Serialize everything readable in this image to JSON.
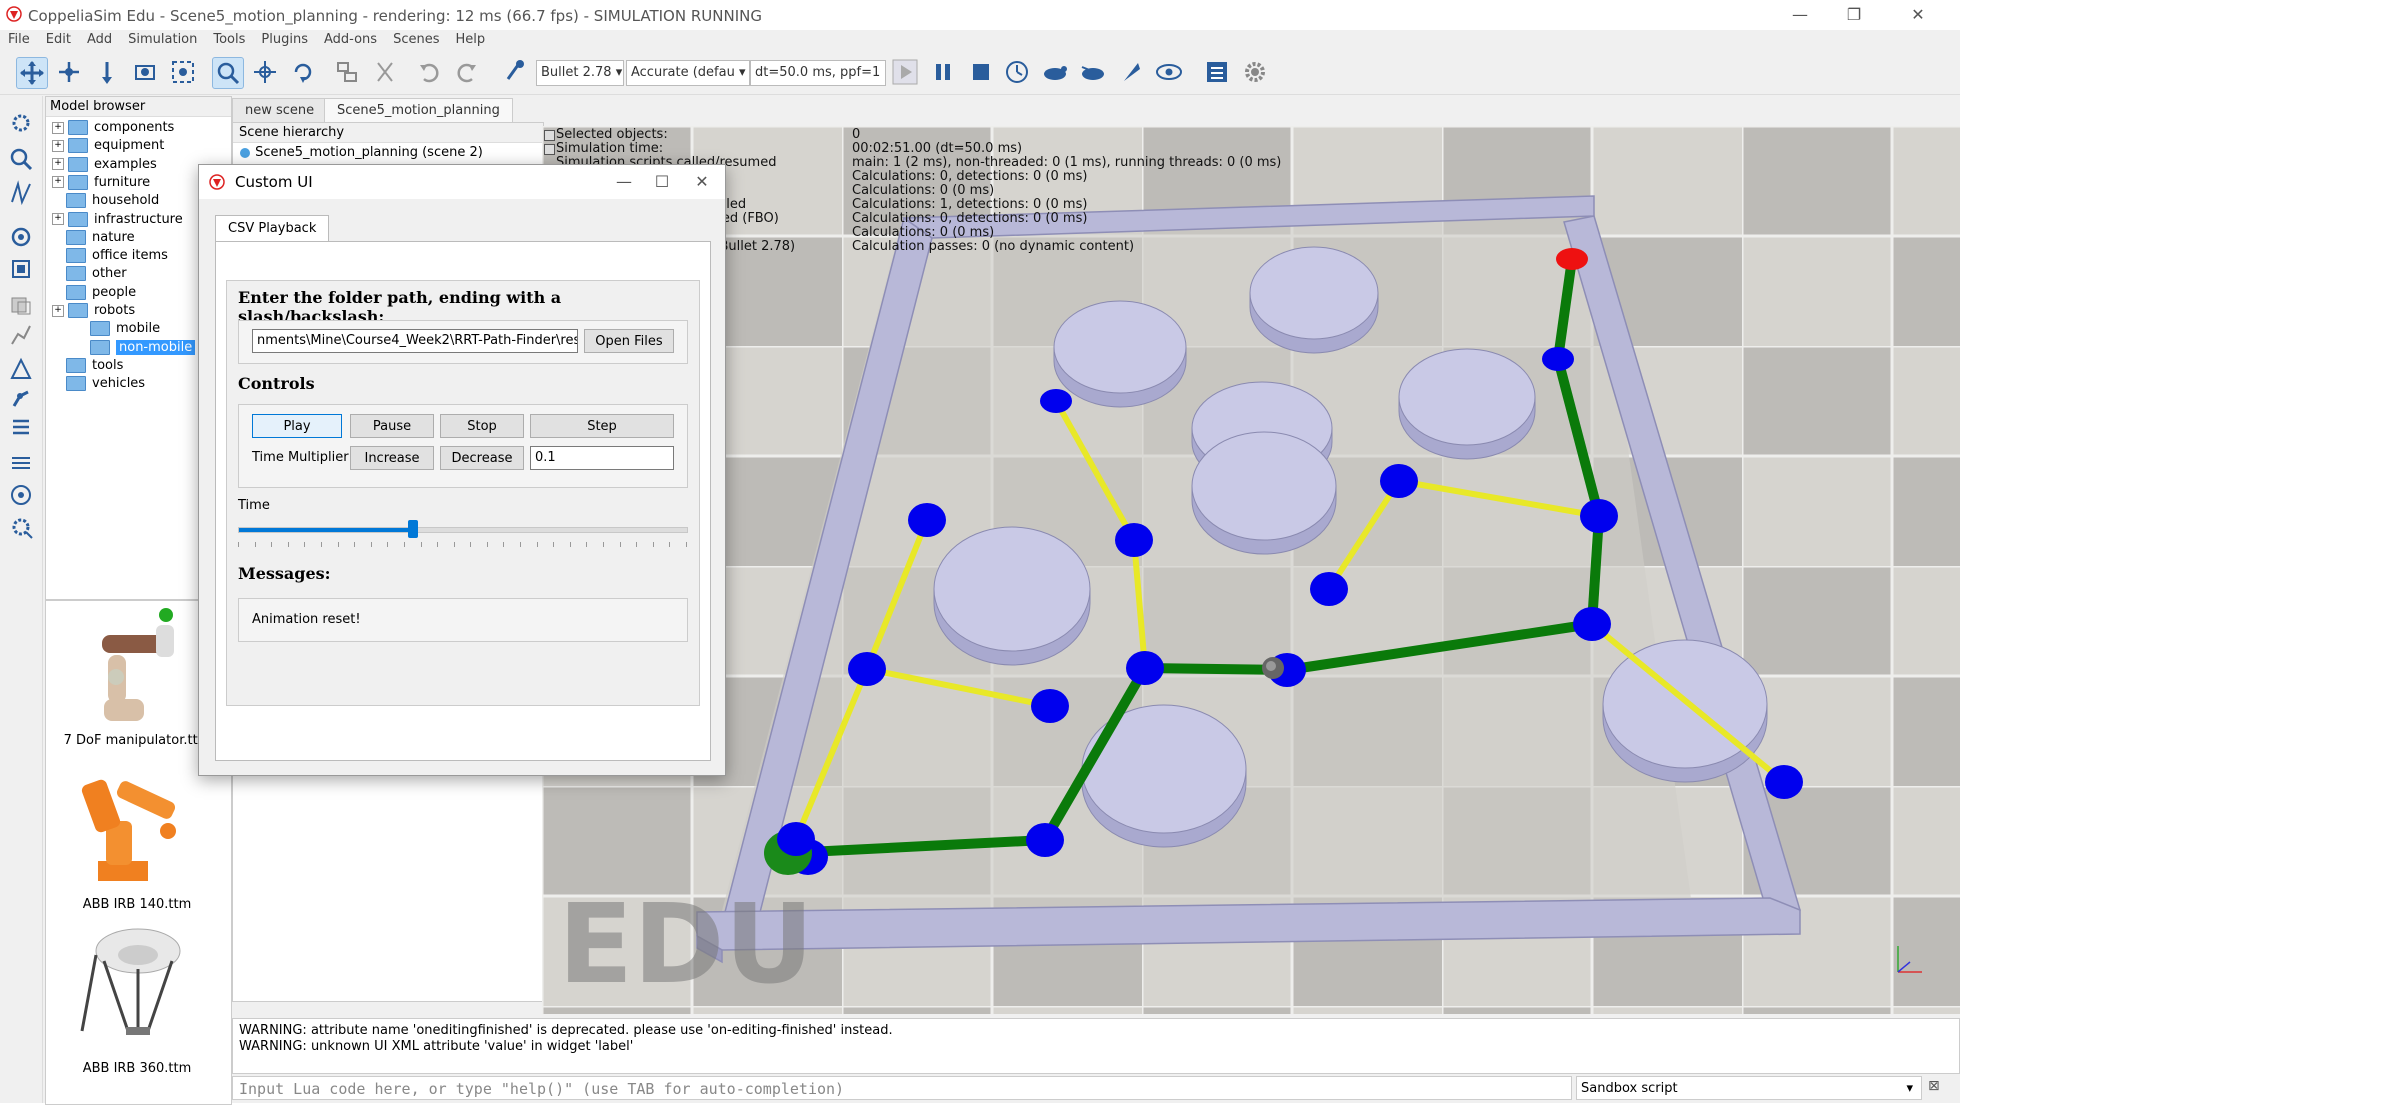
{
  "window": {
    "title": "CoppeliaSim Edu - Scene5_motion_planning - rendering: 12 ms (66.7 fps) - SIMULATION RUNNING",
    "minimize": "—",
    "maximize": "❐",
    "close": "✕"
  },
  "menu": [
    "File",
    "Edit",
    "Add",
    "Simulation",
    "Tools",
    "Plugins",
    "Add-ons",
    "Scenes",
    "Help"
  ],
  "toolbar": {
    "engine": "Bullet 2.78",
    "accuracy": "Accurate (defau",
    "timestep": "dt=50.0 ms, ppf=1"
  },
  "model_browser": {
    "title": "Model browser",
    "items": [
      {
        "label": "components",
        "expandable": true,
        "indent": 0
      },
      {
        "label": "equipment",
        "expandable": true,
        "indent": 0
      },
      {
        "label": "examples",
        "expandable": true,
        "indent": 0
      },
      {
        "label": "furniture",
        "expandable": true,
        "indent": 0
      },
      {
        "label": "household",
        "expandable": false,
        "indent": 0
      },
      {
        "label": "infrastructure",
        "expandable": true,
        "indent": 0
      },
      {
        "label": "nature",
        "expandable": false,
        "indent": 0
      },
      {
        "label": "office items",
        "expandable": false,
        "indent": 0
      },
      {
        "label": "other",
        "expandable": false,
        "indent": 0
      },
      {
        "label": "people",
        "expandable": false,
        "indent": 0
      },
      {
        "label": "robots",
        "expandable": true,
        "indent": 0
      },
      {
        "label": "mobile",
        "expandable": false,
        "indent": 1
      },
      {
        "label": "non-mobile",
        "expandable": false,
        "indent": 1,
        "selected": true
      },
      {
        "label": "tools",
        "expandable": false,
        "indent": 0
      },
      {
        "label": "vehicles",
        "expandable": false,
        "indent": 0
      }
    ],
    "thumbnails": [
      "7 DoF manipulator.ttm",
      "ABB IRB 140.ttm",
      "ABB IRB 360.ttm"
    ]
  },
  "scene_tabs": [
    "new scene",
    "Scene5_motion_planning"
  ],
  "hierarchy": {
    "title": "Scene hierarchy",
    "root": "Scene5_motion_planning (scene 2)"
  },
  "info_overlay": {
    "labels": [
      "Selected objects:",
      "Simulation time:",
      "Simulation scripts called/resumed",
      "abled",
      "bled (FBO)",
      "d (Bullet 2.78)"
    ],
    "values": [
      "0",
      "00:02:51.00 (dt=50.0 ms)",
      "main: 1 (2 ms), non-threaded: 0 (1 ms), running threads: 0 (0 ms)",
      "Calculations: 0, detections: 0 (0 ms)",
      "Calculations: 0 (0 ms)",
      "Calculations: 1, detections: 0 (0 ms)",
      "Calculations: 0, detections: 0 (0 ms)",
      "Calculations: 0 (0 ms)",
      "Calculation passes: 0 (no dynamic content)"
    ]
  },
  "viewport": {
    "watermark": "EDU",
    "colors": {
      "floor_light": "#d7d5d0",
      "floor_dark": "#b7b5b1",
      "wall": "#b8b8d8",
      "obstacle": "#c9c9e6",
      "node": "#0000ee",
      "tree_edge": "#e8e828",
      "path_edge": "#0a7a0a",
      "start": "#1a8a1a",
      "goal": "#ee1111"
    }
  },
  "console": {
    "lines": [
      "WARNING: attribute name 'oneditingfinished' is deprecated. please use 'on-editing-finished' instead.",
      "WARNING: unknown UI XML attribute 'value' in widget 'label'"
    ]
  },
  "command": {
    "placeholder": "Input Lua code here, or type \"help()\" (use TAB for auto-completion)",
    "script_selector": "Sandbox script"
  },
  "dialog": {
    "title": "Custom UI",
    "tab": "CSV Playback",
    "folder_prompt": "Enter the folder path, ending with a slash/backslash:",
    "folder_value": "nments\\Mine\\Course4_Week2\\RRT-Path-Finder\\result\\",
    "open_files": "Open Files",
    "controls_heading": "Controls",
    "play": "Play",
    "pause": "Pause",
    "stop": "Stop",
    "step": "Step",
    "time_multiplier_label": "Time Multiplier",
    "increase": "Increase",
    "decrease": "Decrease",
    "multiplier_value": "0.1",
    "time_label": "Time",
    "time_slider_fraction": 0.39,
    "messages_heading": "Messages:",
    "message": "Animation reset!"
  }
}
